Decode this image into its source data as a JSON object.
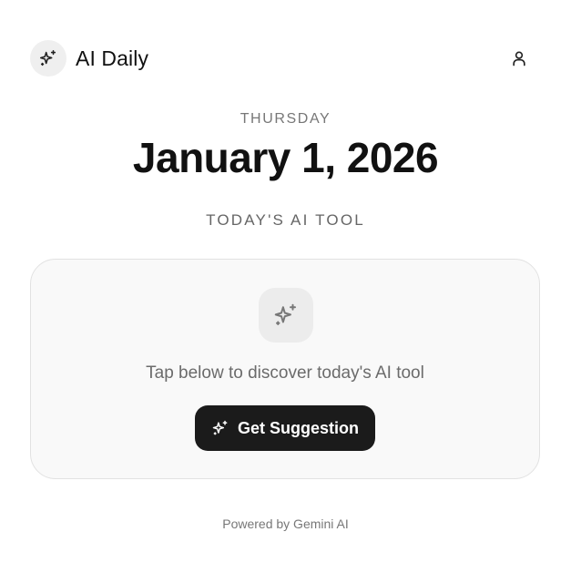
{
  "app": {
    "title": "AI Daily",
    "logo_icon": "sparkles-icon",
    "profile_icon": "user-icon"
  },
  "date": {
    "weekday": "THURSDAY",
    "full": "January 1, 2026"
  },
  "section": {
    "label": "TODAY'S AI TOOL"
  },
  "card": {
    "icon": "sparkles-icon",
    "prompt": "Tap below to discover today's AI tool",
    "button_label": "Get Suggestion",
    "button_icon": "sparkles-icon"
  },
  "footer": {
    "text": "Powered by Gemini AI"
  },
  "colors": {
    "background": "#ffffff",
    "card_background": "#f9f9f9",
    "button_background": "#1b1b1b",
    "muted_text": "#777777"
  }
}
